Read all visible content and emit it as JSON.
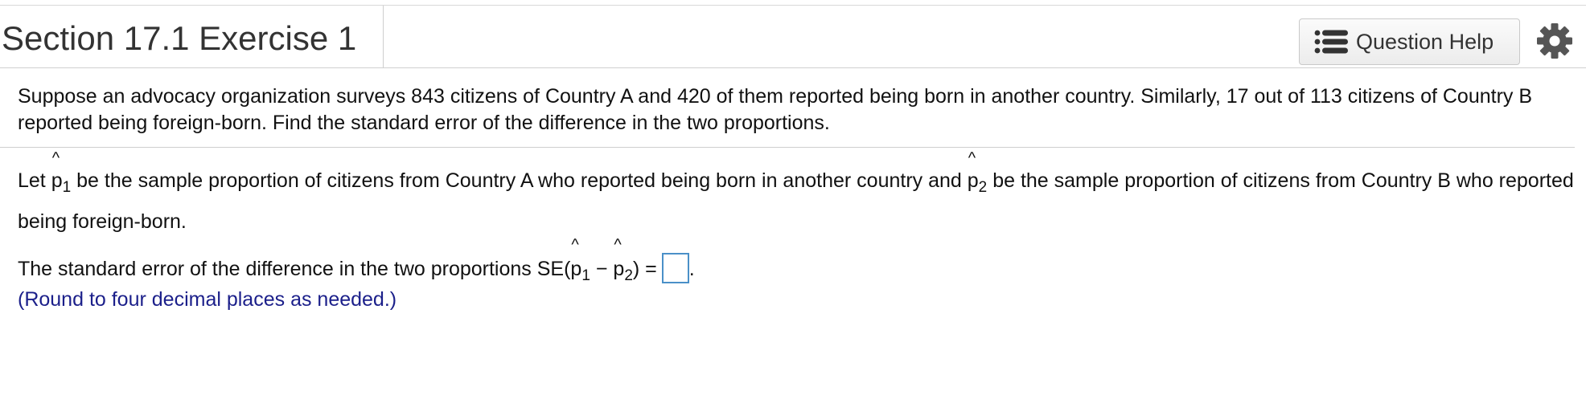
{
  "header": {
    "title": "Section 17.1 Exercise 1",
    "help_button_label": "Question Help",
    "help_icon": "list-icon",
    "settings_icon": "gear-icon"
  },
  "problem": {
    "statement": "Suppose an advocacy organization surveys 843 citizens of Country A and 420 of them reported being born in another country. Similarly, 17 out of 113 citizens of Country B reported being foreign-born. Find the standard error of the difference in the two proportions.",
    "definition": {
      "let": "Let",
      "symbol_p": "p",
      "sub1": "1",
      "sub2": "2",
      "part1": "be the sample proportion of citizens from Country A who reported being born in another country and",
      "part2": "be the sample proportion of citizens from Country B who reported being foreign-born."
    },
    "question": {
      "prefix": "The standard error of the difference in the two proportions SE(",
      "minus": "−",
      "suffix": ") =",
      "answer_value": "",
      "period": "."
    },
    "hint": "(Round to four decimal places as needed.)"
  },
  "colors": {
    "hint": "#1b1f8a",
    "answer_border": "#4a90c8"
  }
}
